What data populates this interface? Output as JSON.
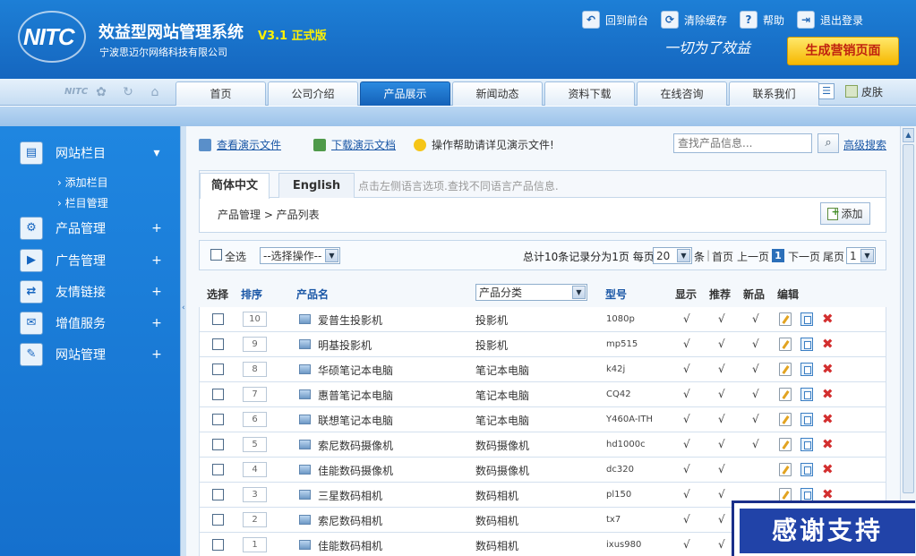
{
  "header": {
    "logo_text": "NITC",
    "title": "效益型网站管理系统",
    "version": "V3.1 正式版",
    "company": "宁波思迈尔网络科技有限公司",
    "slogan": "一切为了效益",
    "top_links": [
      {
        "label": "回到前台",
        "icon": "home-back-icon"
      },
      {
        "label": "清除缓存",
        "icon": "cache-clear-icon"
      },
      {
        "label": "帮助",
        "icon": "help-icon"
      },
      {
        "label": "退出登录",
        "icon": "logout-icon"
      }
    ],
    "generate_button": "生成营销页面"
  },
  "nav": {
    "tabs": [
      "首页",
      "公司介绍",
      "产品展示",
      "新闻动态",
      "资料下载",
      "在线咨询",
      "联系我们"
    ],
    "active_tab": "产品展示",
    "skin_label": "皮肤"
  },
  "sidebar": {
    "items": [
      {
        "label": "网站栏目",
        "icon": "column-icon",
        "sign": "▾"
      },
      {
        "label": "产品管理",
        "icon": "gear-icon",
        "sign": "+"
      },
      {
        "label": "广告管理",
        "icon": "screen-icon",
        "sign": "+"
      },
      {
        "label": "友情链接",
        "icon": "link-icon",
        "sign": "+"
      },
      {
        "label": "增值服务",
        "icon": "chat-icon",
        "sign": "+"
      },
      {
        "label": "网站管理",
        "icon": "tools-icon",
        "sign": "+"
      }
    ],
    "subitems": [
      "添加栏目",
      "栏目管理"
    ]
  },
  "toolbar": {
    "view_demo": "查看演示文件",
    "download_demo": "下载演示文档",
    "help_note": "操作帮助请详见演示文件!",
    "search_placeholder": "查找产品信息...",
    "advanced_search": "高级搜索"
  },
  "lang": {
    "tabs": [
      "简体中文",
      "English"
    ],
    "active": "简体中文",
    "hint": "点击左侧语言选项.查找不同语言产品信息."
  },
  "breadcrumb": "产品管理 > 产品列表",
  "add_button": "添加",
  "controls": {
    "select_all": "全选",
    "action_select": "--选择操作--",
    "summary": "总计10条记录分为1页 每页",
    "per_page": "20",
    "per_page_suffix": "条",
    "first": "首页",
    "prev": "上一页",
    "current_page": "1",
    "next": "下一页",
    "last": "尾页",
    "page_select": "1"
  },
  "table": {
    "headers": {
      "select": "选择",
      "order": "排序",
      "name": "产品名",
      "category": "产品分类",
      "model": "型号",
      "show": "显示",
      "recommend": "推荐",
      "new": "新品",
      "edit": "编辑"
    },
    "rows": [
      {
        "order": "10",
        "name": "爱普生投影机",
        "category": "投影机",
        "model": "1080p",
        "show": "√",
        "recommend": "√",
        "new": "√"
      },
      {
        "order": "9",
        "name": "明基投影机",
        "category": "投影机",
        "model": "mp515",
        "show": "√",
        "recommend": "√",
        "new": "√"
      },
      {
        "order": "8",
        "name": "华硕笔记本电脑",
        "category": "笔记本电脑",
        "model": "k42j",
        "show": "√",
        "recommend": "√",
        "new": "√"
      },
      {
        "order": "7",
        "name": "惠普笔记本电脑",
        "category": "笔记本电脑",
        "model": "CQ42",
        "show": "√",
        "recommend": "√",
        "new": "√"
      },
      {
        "order": "6",
        "name": "联想笔记本电脑",
        "category": "笔记本电脑",
        "model": "Y460A-ITH",
        "show": "√",
        "recommend": "√",
        "new": "√"
      },
      {
        "order": "5",
        "name": "索尼数码摄像机",
        "category": "数码摄像机",
        "model": "hd1000c",
        "show": "√",
        "recommend": "√",
        "new": "√"
      },
      {
        "order": "4",
        "name": "佳能数码摄像机",
        "category": "数码摄像机",
        "model": "dc320",
        "show": "√",
        "recommend": "√",
        "new": ""
      },
      {
        "order": "3",
        "name": "三星数码相机",
        "category": "数码相机",
        "model": "pl150",
        "show": "√",
        "recommend": "√",
        "new": ""
      },
      {
        "order": "2",
        "name": "索尼数码相机",
        "category": "数码相机",
        "model": "tx7",
        "show": "√",
        "recommend": "√",
        "new": ""
      },
      {
        "order": "1",
        "name": "佳能数码相机",
        "category": "数码相机",
        "model": "ixus980",
        "show": "√",
        "recommend": "√",
        "new": ""
      }
    ]
  },
  "overlay_banner": "感谢支持",
  "colors": {
    "header_blue": "#1566bf",
    "accent_yellow": "#f6b700",
    "link_blue": "#1a57a6",
    "delete_red": "#d32f2f"
  }
}
